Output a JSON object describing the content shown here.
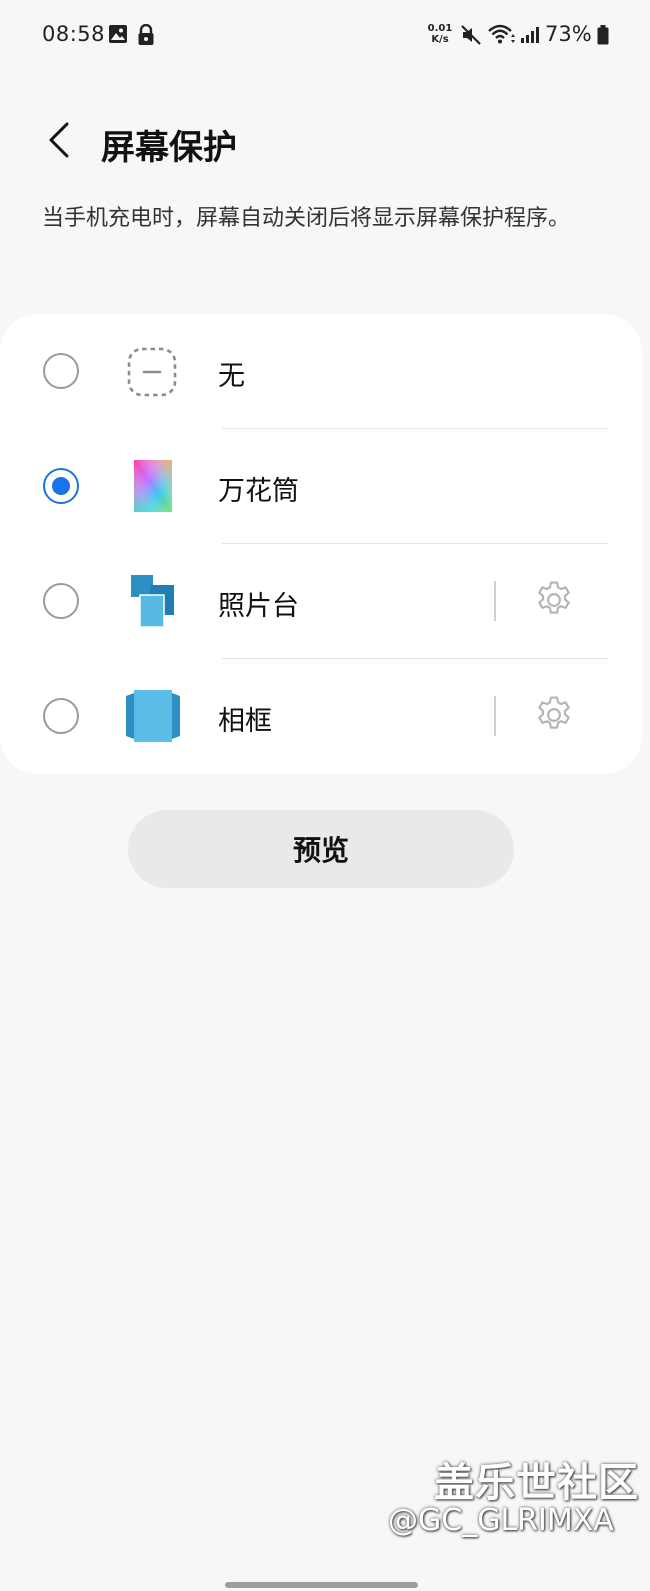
{
  "status_bar": {
    "time": "08:58",
    "net_speed_value": "0.01",
    "net_speed_unit": "K/s",
    "battery": "73%",
    "icons": [
      "gallery-icon",
      "lock-icon",
      "mute-icon",
      "wifi-icon",
      "signal-icon",
      "battery-icon"
    ]
  },
  "header": {
    "title": "屏幕保护",
    "back_icon": "chevron-left-icon"
  },
  "description": "当手机充电时，屏幕自动关闭后将显示屏幕保护程序。",
  "options": [
    {
      "label": "无",
      "icon": "none-icon",
      "selected": false,
      "has_settings": false
    },
    {
      "label": "万花筒",
      "icon": "kaleidoscope-icon",
      "selected": true,
      "has_settings": false
    },
    {
      "label": "照片台",
      "icon": "photo-table-icon",
      "selected": false,
      "has_settings": true
    },
    {
      "label": "相框",
      "icon": "photo-frame-icon",
      "selected": false,
      "has_settings": true
    }
  ],
  "preview_button": {
    "label": "预览"
  },
  "watermark": {
    "title": "盖乐世社区",
    "handle": "@GC_GLRIMXA"
  },
  "colors": {
    "accent": "#1a73e8",
    "background": "#f7f7f7",
    "card": "#ffffff",
    "button": "#e9e9e9"
  }
}
